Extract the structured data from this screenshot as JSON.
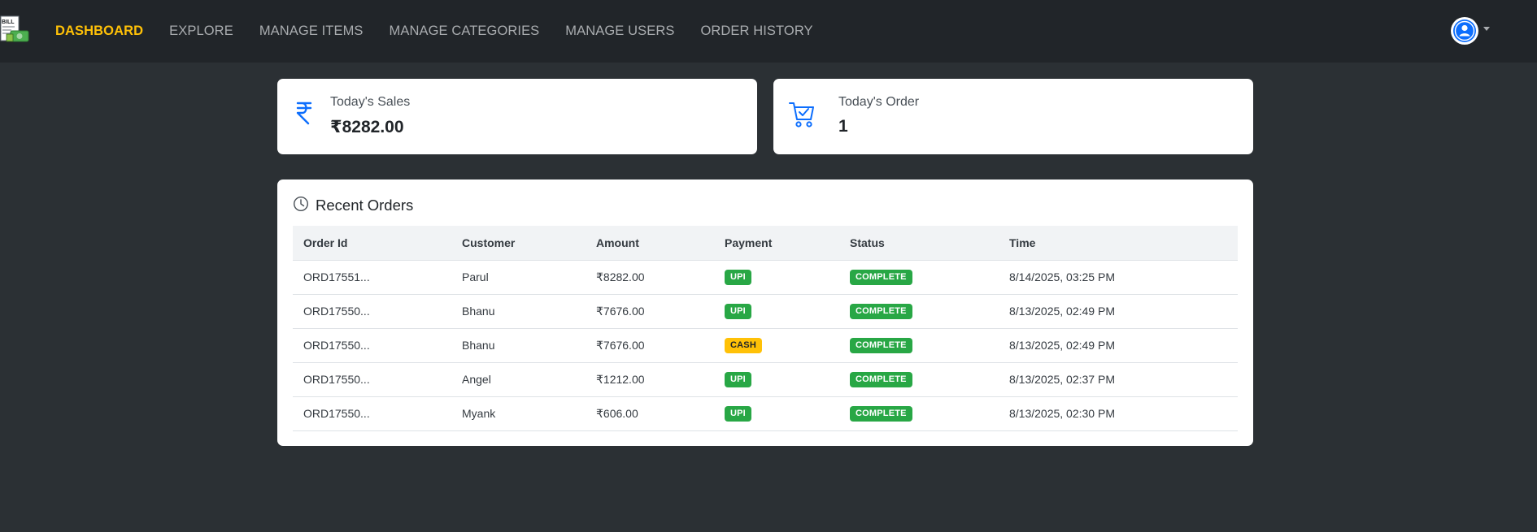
{
  "nav": {
    "items": [
      {
        "label": "DASHBOARD",
        "active": true
      },
      {
        "label": "EXPLORE",
        "active": false
      },
      {
        "label": "MANAGE ITEMS",
        "active": false
      },
      {
        "label": "MANAGE CATEGORIES",
        "active": false
      },
      {
        "label": "MANAGE USERS",
        "active": false
      },
      {
        "label": "ORDER HISTORY",
        "active": false
      }
    ],
    "logo_text": "BILL",
    "user_icon": "user-circle-icon"
  },
  "stats": {
    "sales": {
      "label": "Today's Sales",
      "value": "₹8282.00",
      "icon": "rupee-icon"
    },
    "orders": {
      "label": "Today's Order",
      "value": "1",
      "icon": "cart-check-icon"
    }
  },
  "recent": {
    "title": "Recent Orders",
    "icon": "clock-icon",
    "columns": [
      "Order Id",
      "Customer",
      "Amount",
      "Payment",
      "Status",
      "Time"
    ],
    "rows": [
      {
        "order_id": "ORD17551...",
        "customer": "Parul",
        "amount": "₹8282.00",
        "payment": "UPI",
        "status": "COMPLETE",
        "time": "8/14/2025, 03:25 PM"
      },
      {
        "order_id": "ORD17550...",
        "customer": "Bhanu",
        "amount": "₹7676.00",
        "payment": "UPI",
        "status": "COMPLETE",
        "time": "8/13/2025, 02:49 PM"
      },
      {
        "order_id": "ORD17550...",
        "customer": "Bhanu",
        "amount": "₹7676.00",
        "payment": "CASH",
        "status": "COMPLETE",
        "time": "8/13/2025, 02:49 PM"
      },
      {
        "order_id": "ORD17550...",
        "customer": "Angel",
        "amount": "₹1212.00",
        "payment": "UPI",
        "status": "COMPLETE",
        "time": "8/13/2025, 02:37 PM"
      },
      {
        "order_id": "ORD17550...",
        "customer": "Myank",
        "amount": "₹606.00",
        "payment": "UPI",
        "status": "COMPLETE",
        "time": "8/13/2025, 02:30 PM"
      }
    ]
  },
  "colors": {
    "background": "#2b3034",
    "navbar": "#212529",
    "active_nav": "#ffc107",
    "accent_blue": "#0d6efd",
    "badge_green": "#28a745",
    "badge_yellow": "#ffc107"
  }
}
